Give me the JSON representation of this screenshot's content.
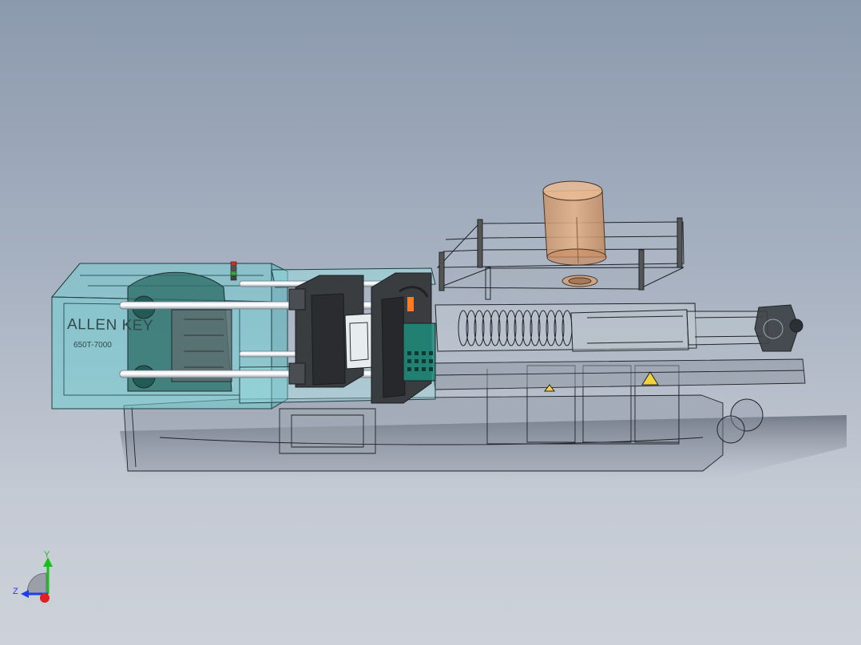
{
  "model": {
    "brand_label": "ALLEN KEY",
    "model_label": "650T-7000"
  },
  "colors": {
    "background_top": "#8c9aae",
    "background_bottom": "#cdd2da",
    "guard_fill": "#6fcfd3",
    "hopper_fill": "#d9a77c",
    "platen_fill": "#3a3d40",
    "wireframe": "#1e2428"
  },
  "triad": {
    "x_label": "",
    "y_label": "Y",
    "z_label": "Z",
    "x_color": "#e02020",
    "y_color": "#18c018",
    "z_color": "#1e3cf0"
  }
}
